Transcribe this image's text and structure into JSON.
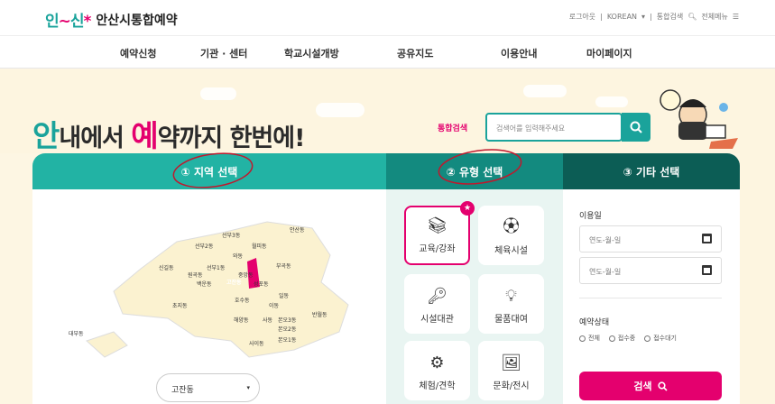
{
  "header": {
    "logo_mark": "안산",
    "site_title": "안산시통합예약",
    "utils": {
      "login": "로그아웃",
      "lang": "KOREAN",
      "search": "통합검색",
      "menu": "전체메뉴"
    }
  },
  "gnb": [
    "예약신청",
    "기관 · 센터",
    "학교시설개방",
    "공유지도",
    "이용안내",
    "마이페이지"
  ],
  "hero": {
    "headline_a": "안",
    "headline_1": "내에서 ",
    "headline_b": "예",
    "headline_2": "약까지 한번에!",
    "search_label": "통합검색",
    "search_placeholder": "검색어를 입력해주세요"
  },
  "tabs": {
    "region": "① 지역 선택",
    "type": "② 유형 선택",
    "other": "③ 기타 선택"
  },
  "map": {
    "dongs": [
      "안산동",
      "선부3동",
      "월피동",
      "선부2동",
      "와동",
      "부곡동",
      "신길동",
      "선부1동",
      "중앙동",
      "원곡동",
      "백운동",
      "고잔동",
      "성포동",
      "초지동",
      "호수동",
      "일동",
      "이동",
      "반월동",
      "해양동",
      "사동",
      "본오3동",
      "본오2동",
      "대부동",
      "사이동",
      "본오1동"
    ],
    "selected": "고잔동"
  },
  "types": [
    {
      "label": "교육/강좌",
      "icon": "books-icon",
      "selected": true
    },
    {
      "label": "체육시설",
      "icon": "soccer-ball-icon",
      "selected": false
    },
    {
      "label": "시설대관",
      "icon": "keys-icon",
      "selected": false
    },
    {
      "label": "물품대여",
      "icon": "bulb-icon",
      "selected": false
    },
    {
      "label": "체험/견학",
      "icon": "gears-icon",
      "selected": false
    },
    {
      "label": "문화/전시",
      "icon": "easel-icon",
      "selected": false
    }
  ],
  "etc": {
    "date_label": "이용일",
    "date_placeholder": "연도-월-일",
    "status_label": "예약상태",
    "status_options": [
      "전체",
      "접수중",
      "접수대기"
    ],
    "search_button": "검색"
  },
  "colors": {
    "teal": "#22b3a4",
    "teal_dark": "#138a7f",
    "teal_darker": "#0c5d55",
    "pink": "#e4006e",
    "bg": "#fdf5e0"
  }
}
